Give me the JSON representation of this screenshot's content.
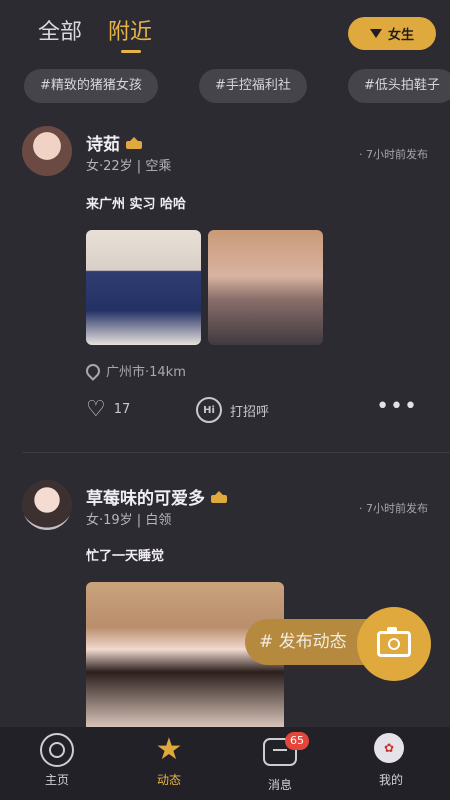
{
  "header": {
    "tab_all": "全部",
    "tab_nearby": "附近",
    "gender_filter": "女生"
  },
  "tags": [
    "#精致的猪猪女孩",
    "#手控福利社",
    "#低头拍鞋子"
  ],
  "posts": [
    {
      "name": "诗茹",
      "meta": "女·22岁 | 空乘",
      "time": "· 7小时前发布",
      "content": "来广州 实习  哈哈",
      "location": "广州市·14km",
      "likes": "17",
      "greet": "打招呼"
    },
    {
      "name": "草莓味的可爱多",
      "meta": "女·19岁 | 白领",
      "time": "· 7小时前发布",
      "content": "忙了一天睡觉"
    }
  ],
  "fab": {
    "label": "# 发布动态"
  },
  "bottom_nav": {
    "home": "主页",
    "moments": "动态",
    "messages": "消息",
    "messages_badge": "65",
    "mine": "我的"
  },
  "colors": {
    "accent": "#e0a93d",
    "background": "#2c2b31",
    "badge": "#e4463b"
  }
}
